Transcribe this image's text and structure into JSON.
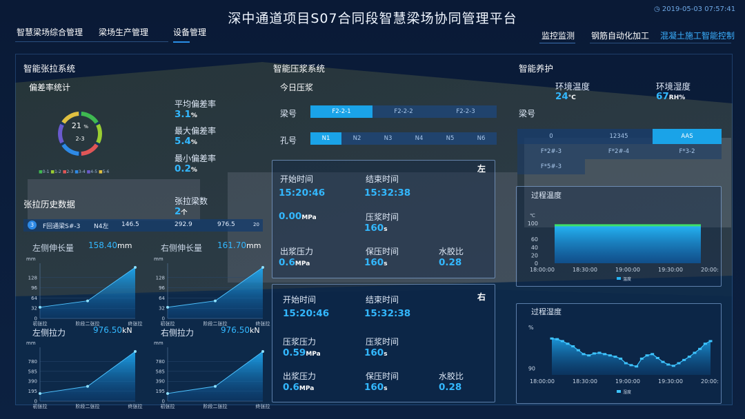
{
  "header": {
    "title": "深中通道项目S07合同段智慧梁场协同管理平台",
    "datetime": "2019-05-03 07:57:41",
    "nav_left": [
      "智慧梁场综合管理",
      "梁场生产管理",
      "设备管理"
    ],
    "nav_right": [
      "监控监测",
      "钢筋自动化加工",
      "混凝土施工智能控制"
    ]
  },
  "tension": {
    "title": "智能张拉系统",
    "deviation_title": "偏差率统计",
    "donut_value": "21",
    "donut_unit": "%",
    "donut_sub": "2-3",
    "legend": [
      "0-1",
      "1-2",
      "2-3",
      "3-4",
      "4-5",
      "5-6"
    ],
    "stats": [
      {
        "label": "平均偏差率",
        "value": "3.1",
        "unit": "%"
      },
      {
        "label": "最大偏差率",
        "value": "5.4",
        "unit": "%"
      },
      {
        "label": "最小偏差率",
        "value": "0.2",
        "unit": "%"
      }
    ],
    "history_title": "张拉历史数据",
    "beam_count_label": "张拉梁数",
    "beam_count_value": "2",
    "beam_count_unit": "个",
    "row": {
      "idx": "3",
      "name": "F回通梁S#-3",
      "pos": "N4左",
      "v1": "146.5",
      "v2": "292.9",
      "v3": "976.5",
      "v4": "20"
    },
    "left_elong_label": "左侧伸长量",
    "left_elong_value": "158.40",
    "left_elong_unit": "mm",
    "right_elong_label": "右侧伸长量",
    "right_elong_value": "161.70",
    "right_elong_unit": "mm",
    "left_force_label": "左侧拉力",
    "left_force_value": "976.50",
    "left_force_unit": "kN",
    "right_force_label": "右侧拉力",
    "right_force_value": "976.50",
    "right_force_unit": "kN"
  },
  "grout": {
    "title": "智能压浆系统",
    "today": "今日压浆",
    "beam_label": "梁号",
    "beams": [
      "F2-2-1",
      "F2-2-2",
      "F2-2-3"
    ],
    "hole_label": "孔号",
    "holes": [
      "N1",
      "N2",
      "N3",
      "N4",
      "N5",
      "N6"
    ],
    "left": {
      "side": "左",
      "start_label": "开始时间",
      "start_value": "15:20:46",
      "end_label": "结束时间",
      "end_value": "15:32:38",
      "pressure_value": "0.00",
      "pressure_unit": "MPa",
      "ptime_label": "压浆时间",
      "ptime_value": "160",
      "ptime_unit": "s",
      "out_label": "出浆压力",
      "out_value": "0.6",
      "out_unit": "MPa",
      "hold_label": "保压时间",
      "hold_value": "160",
      "hold_unit": "s",
      "ratio_label": "水胶比",
      "ratio_value": "0.28"
    },
    "right": {
      "side": "右",
      "start_label": "开始时间",
      "start_value": "15:20:46",
      "end_label": "结束时间",
      "end_value": "15:32:38",
      "pressure_label": "压浆压力",
      "pressure_value": "0.59",
      "pressure_unit": "MPa",
      "ptime_label": "压浆时间",
      "ptime_value": "160",
      "ptime_unit": "s",
      "out_label": "出浆压力",
      "out_value": "0.6",
      "out_unit": "MPa",
      "hold_label": "保压时间",
      "hold_value": "160",
      "hold_unit": "s",
      "ratio_label": "水胶比",
      "ratio_value": "0.28"
    }
  },
  "curing": {
    "title": "智能养护",
    "temp_label": "环境温度",
    "temp_value": "24",
    "temp_unit": "°C",
    "hum_label": "环境湿度",
    "hum_value": "67",
    "hum_unit": "RH%",
    "beam_label": "梁号",
    "table": [
      [
        "0",
        "12345",
        "AAS"
      ],
      [
        "F*2#-3",
        "F*2#-4",
        "F*3-2"
      ],
      [
        "F*5#-3",
        "",
        ""
      ]
    ]
  },
  "colors": {
    "accent": "#33b8ff",
    "donut": [
      "#3fb950",
      "#9acd32",
      "#e05656",
      "#2e8ae6",
      "#6a5acd",
      "#e0c040"
    ]
  },
  "chart_data": [
    {
      "type": "area",
      "title": "",
      "ylabel": "mm",
      "categories": [
        "初张拉",
        "阶段二张拉",
        "终张拉"
      ],
      "yticks": [
        0,
        32,
        64,
        96,
        128
      ],
      "ylim": [
        0,
        160
      ],
      "values": [
        35,
        55,
        160
      ]
    },
    {
      "type": "area",
      "title": "",
      "ylabel": "mm",
      "categories": [
        "初张拉",
        "阶段二张拉",
        "终张拉"
      ],
      "yticks": [
        0,
        32,
        64,
        96,
        128
      ],
      "ylim": [
        0,
        160
      ],
      "values": [
        35,
        55,
        160
      ]
    },
    {
      "type": "area",
      "title": "",
      "ylabel": "mm",
      "categories": [
        "初张拉",
        "阶段二张拉",
        "终张拉"
      ],
      "yticks": [
        0,
        195,
        390,
        585,
        780
      ],
      "ylim": [
        0,
        976.5
      ],
      "values": [
        150,
        290,
        976.5
      ]
    },
    {
      "type": "area",
      "title": "",
      "ylabel": "mm",
      "categories": [
        "初张拉",
        "阶段二张拉",
        "终张拉"
      ],
      "yticks": [
        0,
        195,
        390,
        585,
        780
      ],
      "ylim": [
        0,
        976.5
      ],
      "values": [
        150,
        290,
        976.5
      ]
    },
    {
      "type": "area",
      "title": "过程温度",
      "ylabel": "℃",
      "categories": [
        "18:00:00",
        "18:30:00",
        "19:00:00",
        "19:30:00",
        "20:00:00"
      ],
      "yticks": [
        0,
        20,
        40,
        60,
        100
      ],
      "ylim": [
        0,
        100
      ],
      "series": [
        {
          "name": "温度",
          "values": [
            95,
            95,
            95,
            95,
            95
          ]
        }
      ]
    },
    {
      "type": "line",
      "title": "过程湿度",
      "ylabel": "%",
      "categories": [
        "18:00:00",
        "18:30:00",
        "19:00:00",
        "19:30:00",
        "20:00:00"
      ],
      "yticks": [
        90
      ],
      "ylim": [
        89,
        96
      ],
      "series": [
        {
          "name": "湿度",
          "values": [
            94.6,
            94.5,
            94.2,
            93.8,
            93.4,
            92.8,
            92.2,
            92.0,
            92.3,
            92.4,
            92.2,
            92.0,
            91.8,
            91.5,
            90.8,
            90.5,
            90.3,
            91.5,
            92.0,
            92.2,
            91.6,
            91.0,
            90.6,
            90.4,
            90.8,
            91.3,
            91.8,
            92.4,
            93.0,
            93.8,
            94.2
          ]
        }
      ]
    }
  ]
}
